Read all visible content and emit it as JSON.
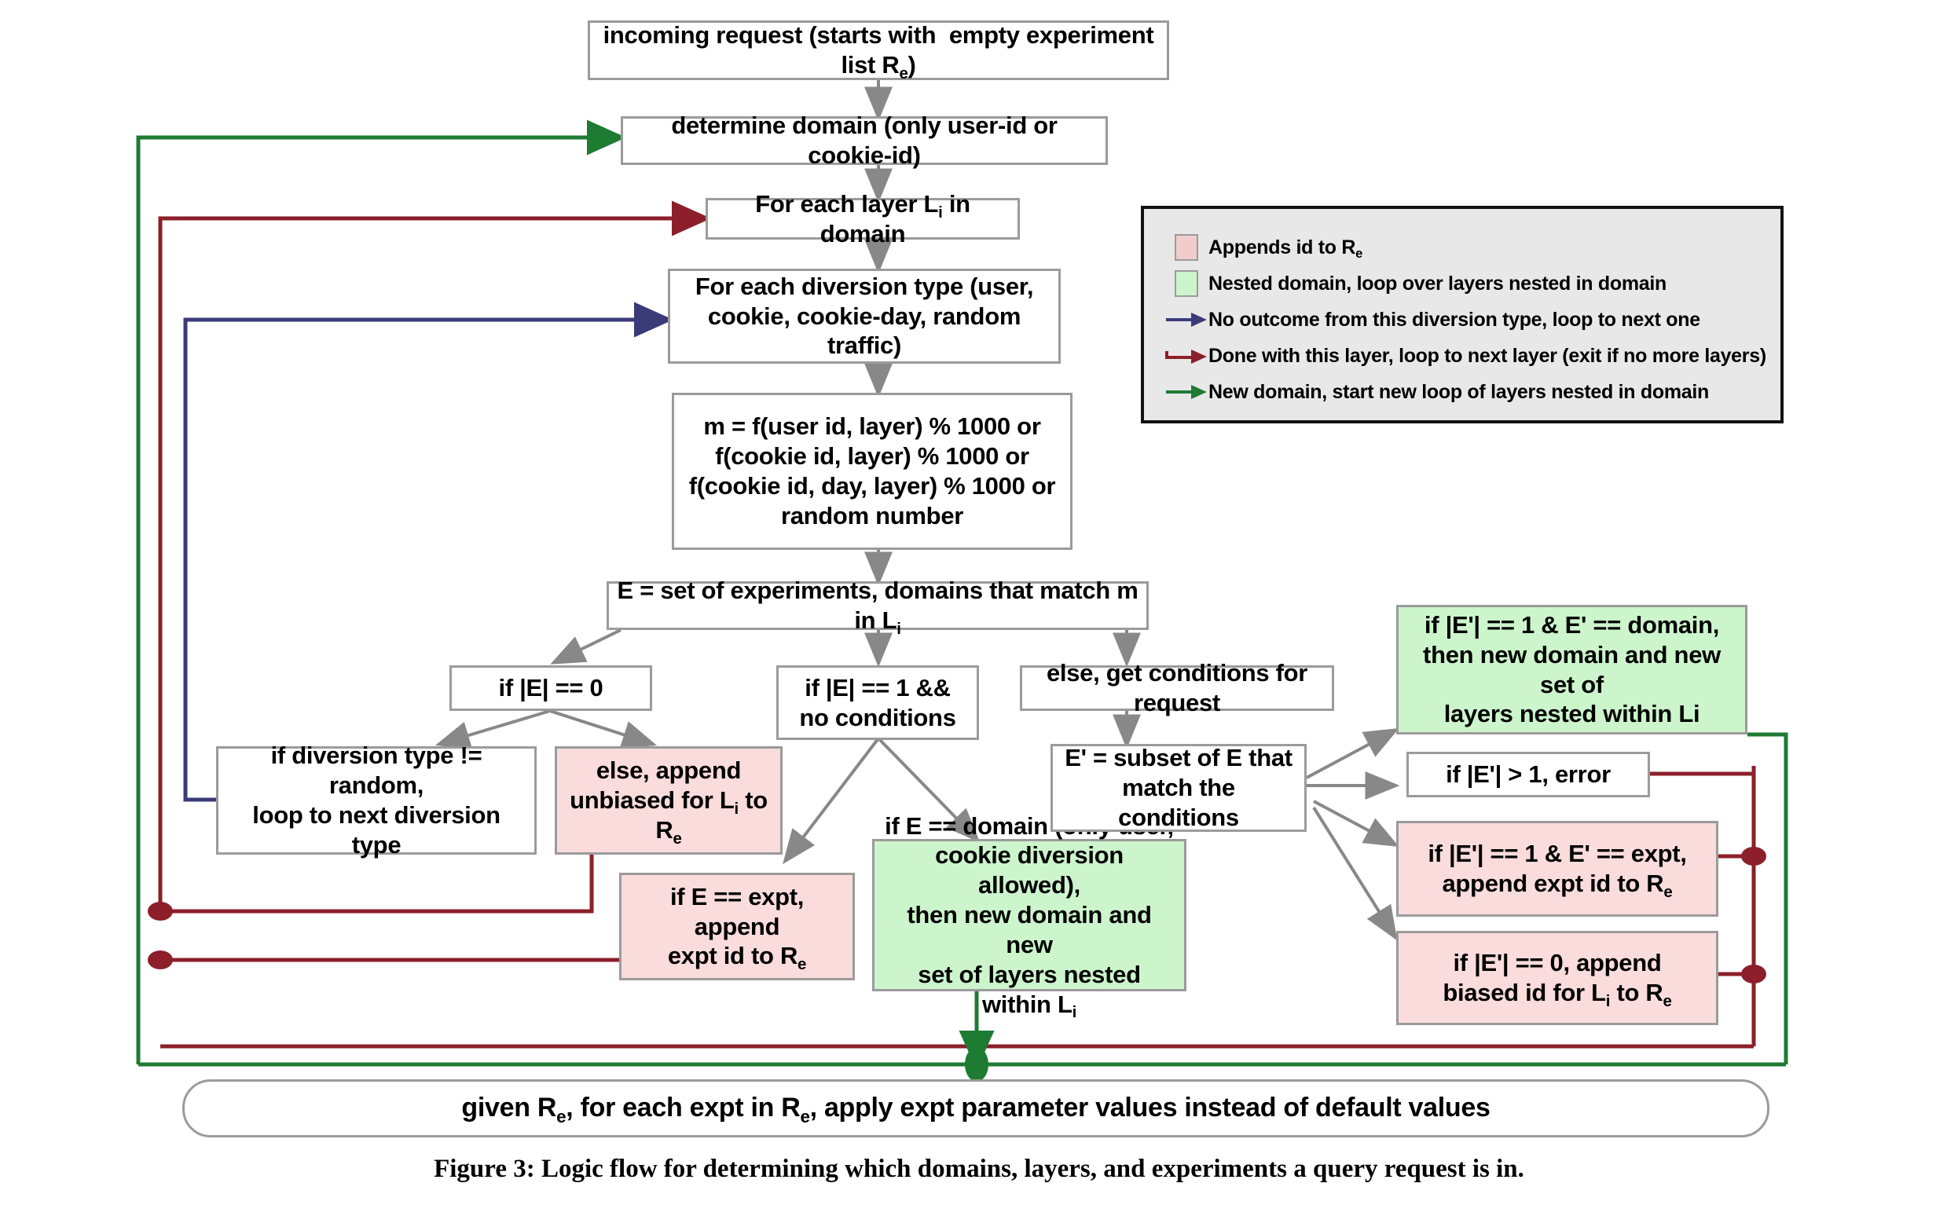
{
  "figure": {
    "caption": "Figure 3: Logic flow for determining which domains, layers, and experiments a query request is in."
  },
  "colors": {
    "box_border": "#9b9b9b",
    "pink_fill": "#fadcdc",
    "green_fill": "#ccf5cc",
    "arrow_gray": "#888888",
    "loop_navy": "#3b3b7a",
    "loop_darkred": "#8c1f2a",
    "loop_green": "#1e7b32",
    "legend_bg": "#e8e8e8"
  },
  "nodes": {
    "incoming_request": "incoming request (starts with  empty experiment list Rₑ)",
    "determine_domain": "determine domain (only user-id or cookie-id)",
    "for_each_layer": "For each layer Lᵢ in domain",
    "for_each_diversion": "For each diversion type (user, cookie, cookie-day, random traffic)",
    "m_formula": "m = f(user id, layer) % 1000 or f(cookie id, layer) % 1000 or f(cookie id, day, layer) % 1000 or random number",
    "e_set": "E = set of experiments, domains that match m in Lᵢ",
    "if_e_zero": "if |E| == 0",
    "if_e_one_nocond": "if |E| == 1 && no conditions",
    "else_get_conditions": "else, get conditions for request",
    "if_diversion_not_random": "if diversion type != random, loop to next diversion type",
    "else_append_unbiased": "else, append unbiased for Lᵢ to Rₑ",
    "if_e_expt_append": "if E == expt, append expt id to Rₑ",
    "if_e_domain": "if E == domain (only user, cookie diversion allowed), then new domain and new set of layers nested within Lᵢ",
    "e_prime_subset": "E' = subset of E that match the conditions",
    "if_ep_one_domain": "if |E'| == 1 & E' == domain, then new domain and new set of layers nested within Li",
    "if_ep_gt_one_error": "if |E'| > 1, error",
    "if_ep_one_expt": "if |E'| == 1 & E' == expt, append expt id to Rₑ",
    "if_ep_zero": "if |E'| == 0, append biased id for Lᵢ to Rₑ",
    "final": "given Rₑ, for each expt in Rₑ, apply expt parameter values instead of default values"
  },
  "legend": {
    "items": [
      {
        "mark": "pink-swatch",
        "label": "Appends id to Rₑ"
      },
      {
        "mark": "green-swatch",
        "label": "Nested domain, loop over layers nested in domain"
      },
      {
        "mark": "navy-arrow",
        "label": "No outcome from this diversion type, loop to next one"
      },
      {
        "mark": "darkred-arrow",
        "label": "Done with this layer, loop to next layer (exit if no more layers)"
      },
      {
        "mark": "green-arrow",
        "label": "New domain, start new loop of layers nested in domain"
      }
    ]
  }
}
